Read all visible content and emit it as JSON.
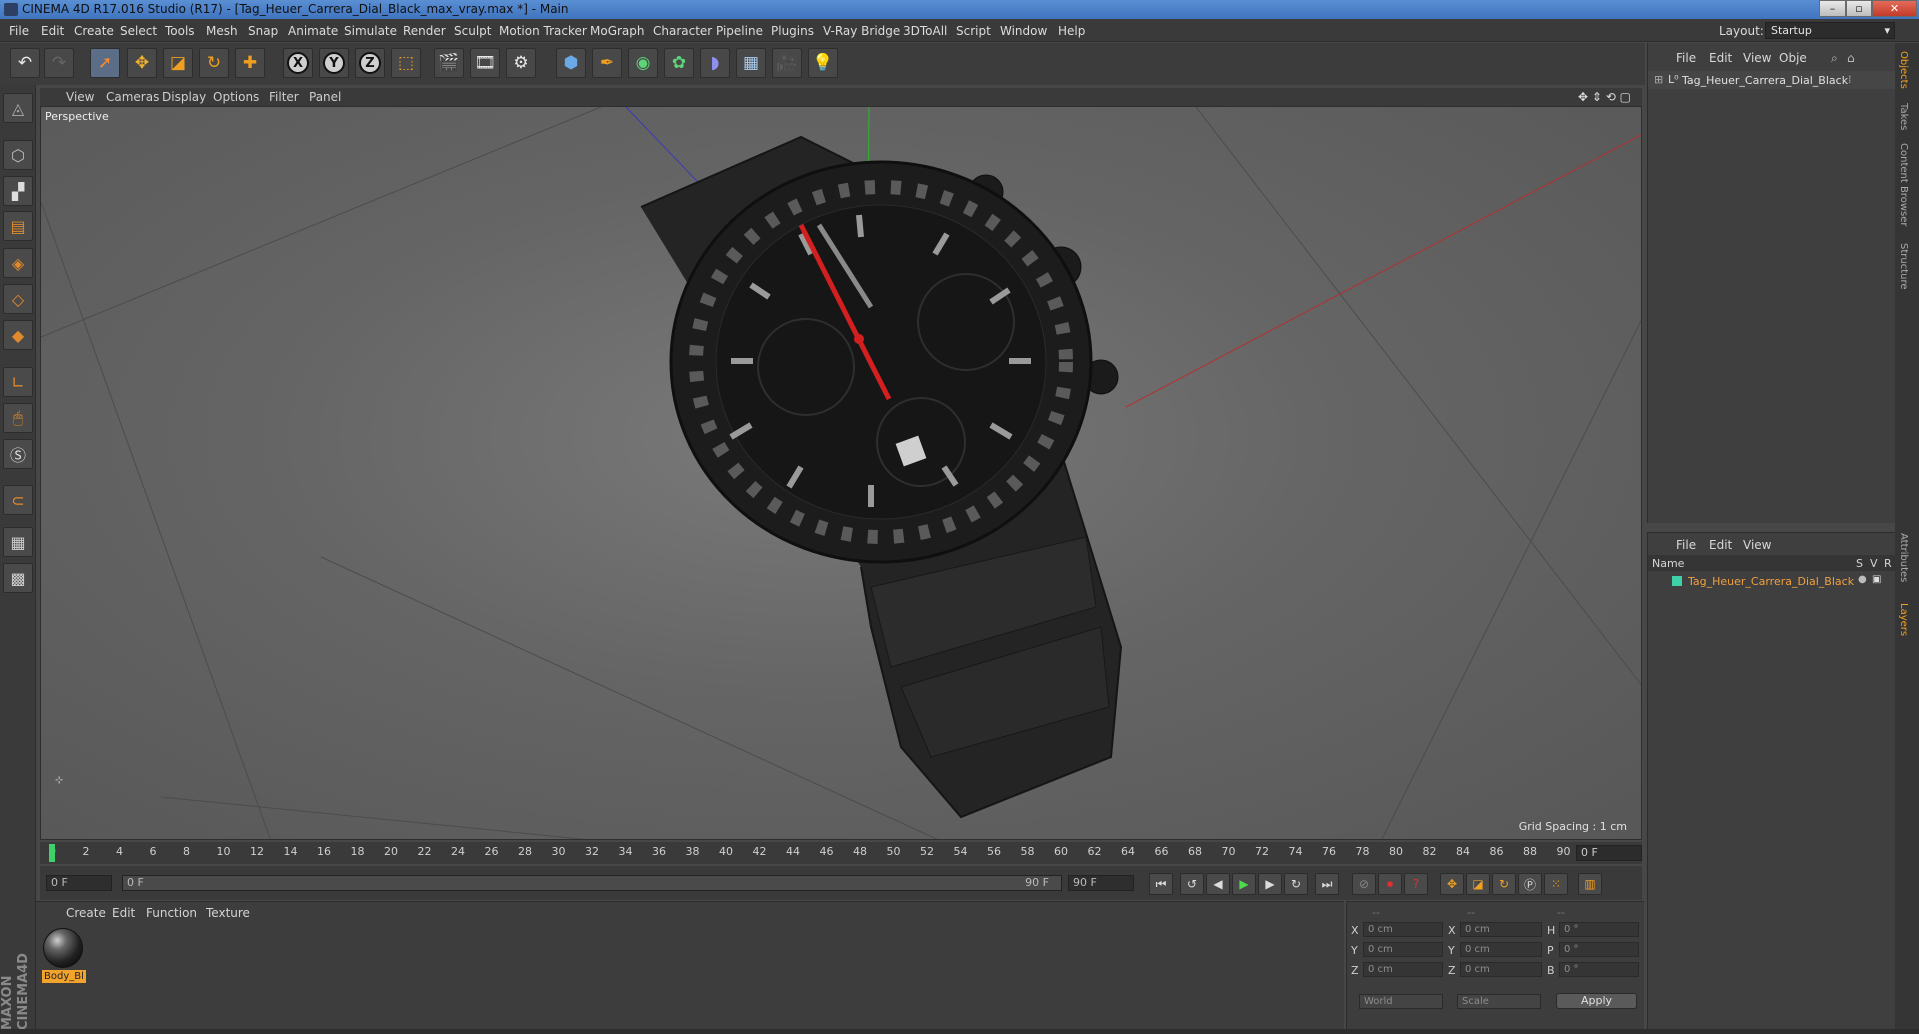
{
  "window": {
    "title": "CINEMA 4D R17.016 Studio (R17) - [Tag_Heuer_Carrera_Dial_Black_max_vray.max *] - Main"
  },
  "menubar": {
    "items": [
      "File",
      "Edit",
      "Create",
      "Select",
      "Tools",
      "Mesh",
      "Snap",
      "Animate",
      "Simulate",
      "Render",
      "Sculpt",
      "Motion Tracker",
      "MoGraph",
      "Character",
      "Pipeline",
      "Plugins",
      "V-Ray Bridge",
      "3DToAll",
      "Script",
      "Window",
      "Help"
    ],
    "layout_label": "Layout:",
    "layout_value": "Startup"
  },
  "toolbar": {
    "x": "X",
    "y": "Y",
    "z": "Z"
  },
  "viewport": {
    "menu": [
      "View",
      "Cameras",
      "Display",
      "Options",
      "Filter",
      "Panel"
    ],
    "label": "Perspective",
    "grid_spacing": "Grid Spacing : 1 cm"
  },
  "timeline": {
    "ticks": [
      "0",
      "2",
      "4",
      "6",
      "8",
      "10",
      "12",
      "14",
      "16",
      "18",
      "20",
      "22",
      "24",
      "26",
      "28",
      "30",
      "32",
      "34",
      "36",
      "38",
      "40",
      "42",
      "44",
      "46",
      "48",
      "50",
      "52",
      "54",
      "56",
      "58",
      "60",
      "62",
      "64",
      "66",
      "68",
      "70",
      "72",
      "74",
      "76",
      "78",
      "80",
      "82",
      "84",
      "86",
      "88",
      "90"
    ],
    "current_frame": "0 F",
    "start": "0 F",
    "range_start": "0 F",
    "range_end": "90 F",
    "end": "90 F"
  },
  "materials": {
    "menu": [
      "Create",
      "Edit",
      "Function",
      "Texture"
    ],
    "items": [
      {
        "name": "Body_Bl"
      }
    ]
  },
  "coordinates": {
    "header": [
      "--",
      "--",
      "--"
    ],
    "rows": [
      {
        "a": "X",
        "av": "0 cm",
        "b": "X",
        "bv": "0 cm",
        "c": "H",
        "cv": "0 °"
      },
      {
        "a": "Y",
        "av": "0 cm",
        "b": "Y",
        "bv": "0 cm",
        "c": "P",
        "cv": "0 °"
      },
      {
        "a": "Z",
        "av": "0 cm",
        "b": "Z",
        "bv": "0 cm",
        "c": "B",
        "cv": "0 °"
      }
    ],
    "mode": "World",
    "scale": "Scale",
    "apply": "Apply"
  },
  "objects": {
    "menu": [
      "File",
      "Edit",
      "View",
      "Obje"
    ],
    "items": [
      {
        "name": "Tag_Heuer_Carrera_Dial_Black"
      }
    ]
  },
  "layers": {
    "menu": [
      "File",
      "Edit",
      "View"
    ],
    "columns": {
      "name": "Name",
      "s": "S",
      "v": "V",
      "r": "R"
    },
    "items": [
      {
        "name": "Tag_Heuer_Carrera_Dial_Black",
        "color": "#3fd0a8"
      }
    ]
  },
  "right_tabs": [
    "Objects",
    "Takes",
    "Content Browser",
    "Structure",
    "Attributes",
    "Layers"
  ],
  "brand": {
    "text": "MAXON CINEMA4D"
  },
  "colors": {
    "accent": "#f2a32b",
    "layer_name": "#f0a040"
  }
}
